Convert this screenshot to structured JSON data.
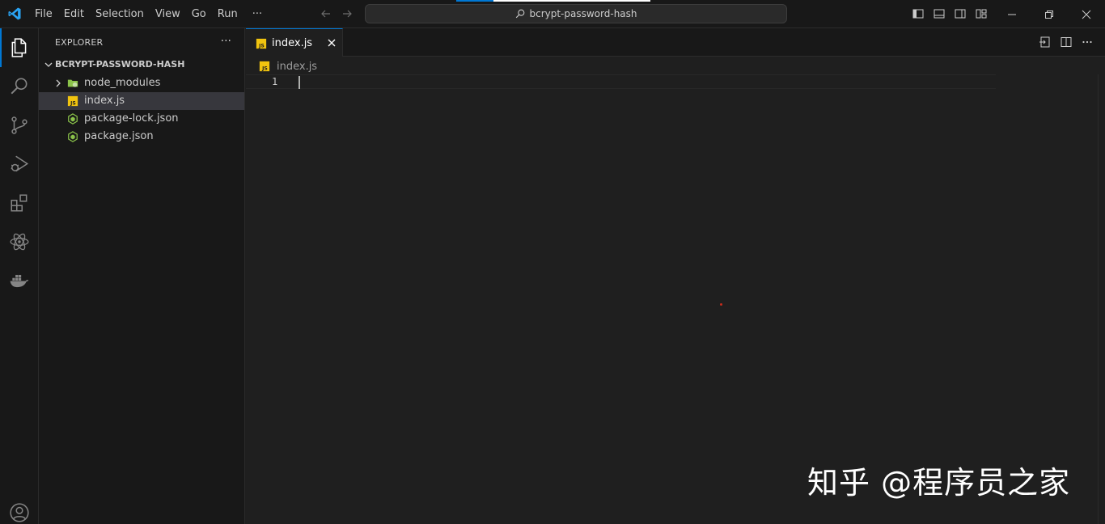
{
  "titlebar": {
    "menu": [
      "File",
      "Edit",
      "Selection",
      "View",
      "Go",
      "Run",
      "···"
    ],
    "command_center": "bcrypt-password-hash",
    "icons": [
      "toggle-primary-sidebar-icon",
      "toggle-panel-icon",
      "toggle-secondary-sidebar-icon",
      "customize-layout-icon"
    ],
    "window_controls": [
      "minimize-icon",
      "restore-icon",
      "close-icon"
    ]
  },
  "activitybar": {
    "items": [
      "explorer-icon",
      "search-icon",
      "source-control-icon",
      "run-debug-icon",
      "extensions-icon",
      "react-icon",
      "docker-icon"
    ],
    "bottom": [
      "accounts-icon"
    ]
  },
  "sidebar": {
    "title": "EXPLORER",
    "more": "···",
    "folder": "BCRYPT-PASSWORD-HASH",
    "items": [
      {
        "label": "node_modules",
        "icon": "node-folder-icon"
      },
      {
        "label": "index.js",
        "icon": "js-file-icon",
        "selected": true
      },
      {
        "label": "package-lock.json",
        "icon": "node-json-icon"
      },
      {
        "label": "package.json",
        "icon": "node-json-icon"
      }
    ]
  },
  "editor": {
    "tab": {
      "label": "index.js",
      "icon": "js-file-icon"
    },
    "breadcrumb": "index.js",
    "line_number": "1",
    "actions": [
      "open-changes-icon",
      "split-editor-icon",
      "more-actions-icon"
    ]
  },
  "watermark": "知乎 @程序员之家",
  "colors": {
    "accent": "#0078d4",
    "js_yellow": "#f1c40f",
    "node_green": "#8bc34a",
    "background": "#1f1f1f",
    "chrome": "#181818"
  }
}
